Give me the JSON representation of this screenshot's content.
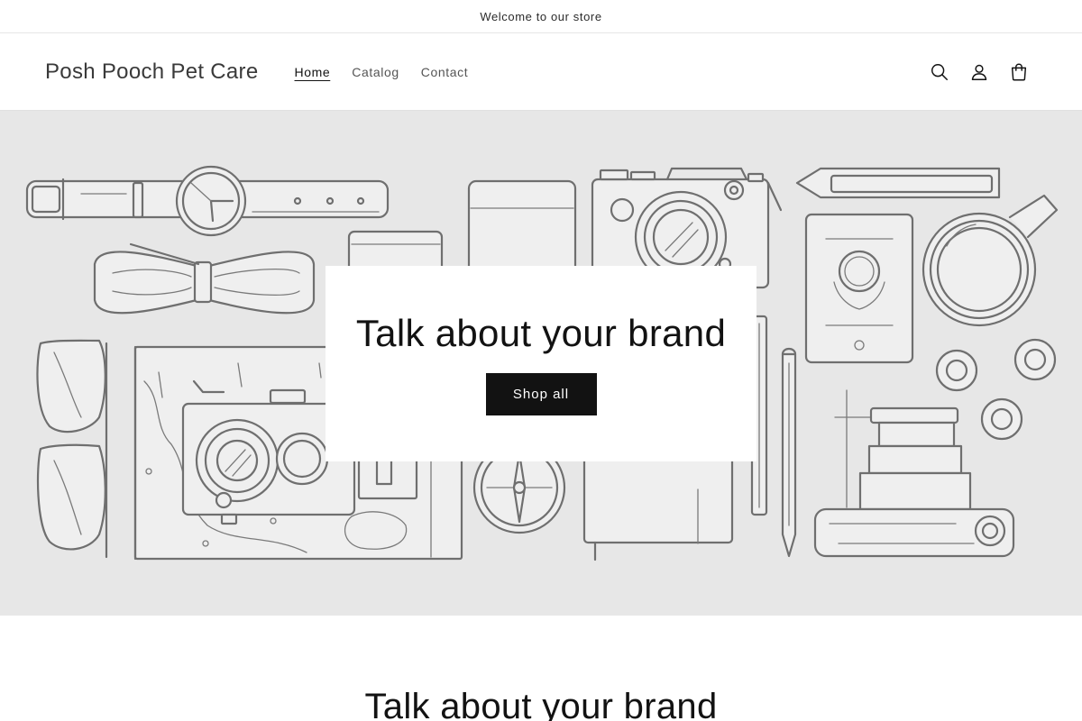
{
  "announcement": {
    "text": "Welcome to our store"
  },
  "header": {
    "logo": "Posh Pooch Pet Care",
    "nav": [
      {
        "label": "Home",
        "active": true
      },
      {
        "label": "Catalog",
        "active": false
      },
      {
        "label": "Contact",
        "active": false
      }
    ],
    "icons": [
      "search-icon",
      "account-icon",
      "cart-icon"
    ]
  },
  "hero": {
    "heading": "Talk about your brand",
    "button_label": "Shop all"
  },
  "section": {
    "heading": "Talk about your brand"
  },
  "colors": {
    "text": "#121212",
    "hero_background": "#e7e7e7",
    "button_background": "#121212",
    "button_text": "#ffffff",
    "illustration_stroke": "#6f6f6f"
  }
}
